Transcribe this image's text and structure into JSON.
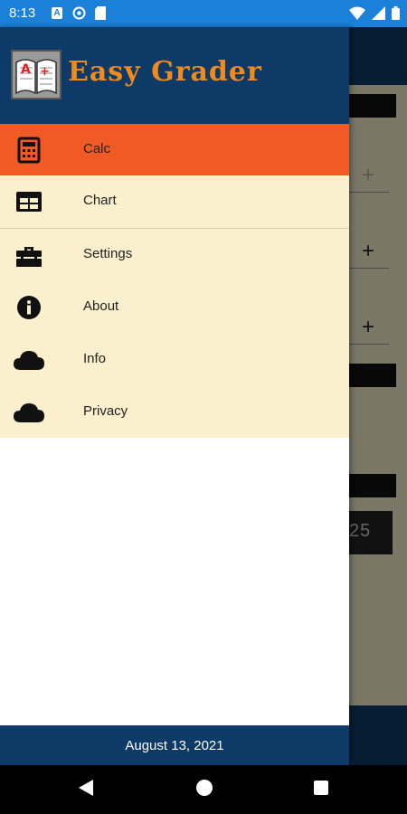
{
  "status_bar": {
    "time": "8:13",
    "icons": [
      "a-icon",
      "sync-icon",
      "sd-card-icon",
      "wifi-icon",
      "signal-icon",
      "battery-icon"
    ]
  },
  "drawer": {
    "app_title": "Easy Grader",
    "menu": [
      {
        "label": "Calc",
        "icon": "calculator-icon",
        "active": true
      },
      {
        "label": "Chart",
        "icon": "table-icon",
        "active": false
      },
      {
        "label": "Settings",
        "icon": "toolbox-icon",
        "active": false
      },
      {
        "label": "About",
        "icon": "info-icon",
        "active": false
      },
      {
        "label": "Info",
        "icon": "cloud-icon",
        "active": false
      },
      {
        "label": "Privacy",
        "icon": "cloud-icon",
        "active": false
      }
    ],
    "footer_date": "August 13, 2021"
  },
  "background": {
    "visible_value": "25"
  },
  "colors": {
    "brand_navy": "#0d3a66",
    "accent_orange": "#f05a24",
    "title_orange": "#f08a1c",
    "menu_cream": "#faf0cd",
    "status_blue": "#1a80d8"
  }
}
